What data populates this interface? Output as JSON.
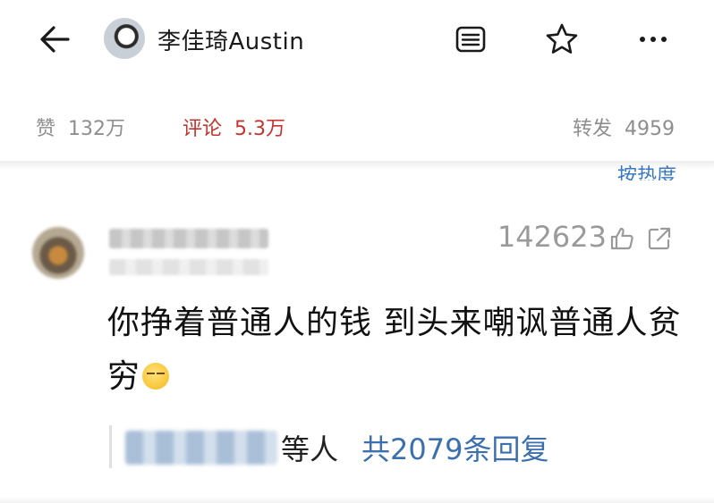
{
  "header": {
    "author_name": "李佳琦Austin",
    "icons": [
      "back-arrow-icon",
      "reader-icon",
      "star-icon",
      "more-icon"
    ]
  },
  "stats": {
    "likes_label": "赞",
    "likes_value": "132万",
    "comments_label": "评论",
    "comments_value": "5.3万",
    "reposts_label": "转发",
    "reposts_value": "4959"
  },
  "sort": {
    "label_partial": "按热度"
  },
  "comment": {
    "like_count": "142623",
    "text": "你挣着普通人的钱 到头来嘲讽普通人贫穷",
    "emoji_icon": "smirk-emoji-icon",
    "reply_suffix": "等人",
    "reply_count_text": "共2079条回复"
  },
  "colors": {
    "accent_red": "#c4342e",
    "link_blue": "#3b6fb0",
    "muted_gray": "#8e8e8e"
  }
}
